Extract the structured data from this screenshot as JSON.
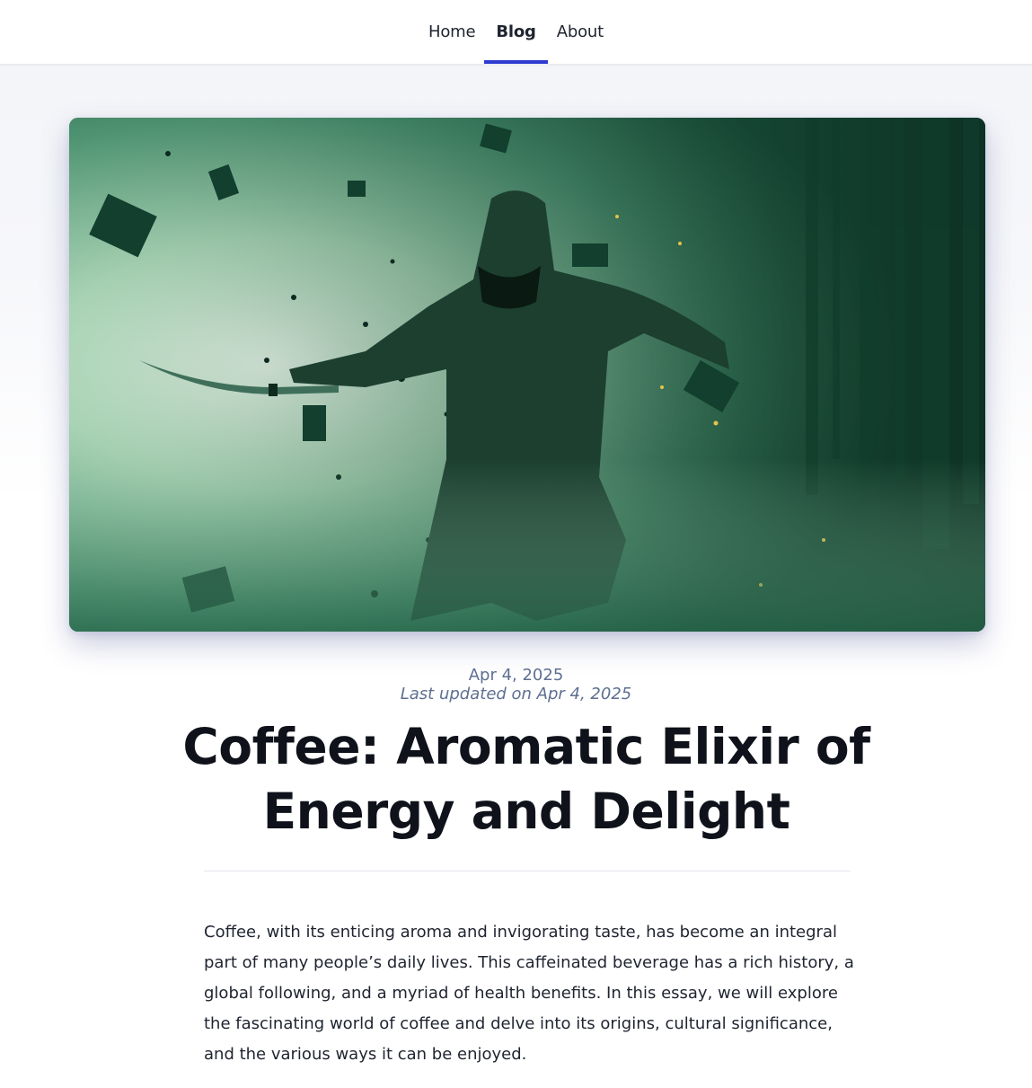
{
  "nav": {
    "items": [
      {
        "label": "Home",
        "active": false
      },
      {
        "label": "Blog",
        "active": true
      },
      {
        "label": "About",
        "active": false
      }
    ],
    "accent_color": "#2d3ad1"
  },
  "hero": {
    "image_description": "hooded-ninja-with-sword-exploding-circuitry-green"
  },
  "post": {
    "date": "Apr 4, 2025",
    "updated": "Last updated on Apr 4, 2025",
    "title": "Coffee: Aromatic Elixir of Energy and Delight",
    "intro": "Coffee, with its enticing aroma and invigorating taste, has become an integral part of many people’s daily lives. This caffeinated beverage has a rich history, a global following, and a myriad of health benefits. In this essay, we will explore the fascinating world of coffee and delve into its origins, cultural significance, and the various ways it can be enjoyed."
  }
}
